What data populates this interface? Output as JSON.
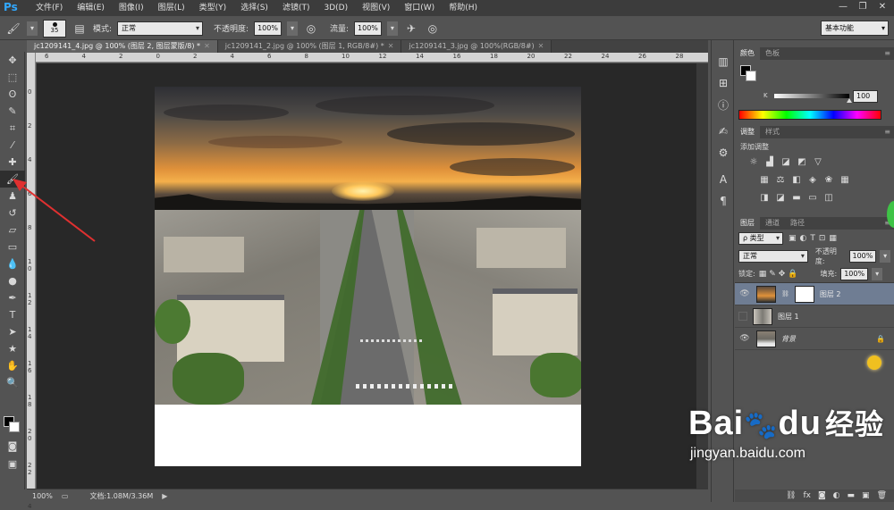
{
  "app": {
    "logo": "Ps"
  },
  "menu": [
    "文件(F)",
    "编辑(E)",
    "图像(I)",
    "图层(L)",
    "类型(Y)",
    "选择(S)",
    "滤镜(T)",
    "3D(D)",
    "视图(V)",
    "窗口(W)",
    "帮助(H)"
  ],
  "window_controls": [
    "—",
    "❐",
    "✕"
  ],
  "options": {
    "brush_size": "35",
    "mode_label": "模式:",
    "mode_value": "正常",
    "opacity_label": "不透明度:",
    "opacity_value": "100%",
    "flow_label": "流量:",
    "flow_value": "100%",
    "workspace": "基本功能"
  },
  "tabs": [
    {
      "label": "jc1209141_4.jpg @ 100% (图层 2, 图层蒙版/8) *",
      "active": true
    },
    {
      "label": "jc1209141_2.jpg @ 100% (图层 1, RGB/8#) *",
      "active": false
    },
    {
      "label": "jc1209141_3.jpg @ 100%(RGB/8#)",
      "active": false
    }
  ],
  "ruler_top": [
    "6",
    "4",
    "2",
    "0",
    "2",
    "4",
    "6",
    "8",
    "10",
    "12",
    "14",
    "16",
    "18",
    "20",
    "22",
    "24",
    "26",
    "28"
  ],
  "ruler_left": [
    "0",
    "2",
    "4",
    "6",
    "8",
    "1 0",
    "1 2",
    "1 4",
    "1 6",
    "1 8",
    "2 0",
    "2 2",
    "2 4"
  ],
  "status": {
    "zoom": "100%",
    "doc_info": "文档:1.08M/3.36M"
  },
  "color_panel": {
    "tabs": [
      "颜色",
      "色板"
    ],
    "channel_label": "K",
    "channel_value": "100",
    "channel_level": 1.0
  },
  "adjust_panel": {
    "tabs": [
      "调整",
      "样式"
    ],
    "title": "添加调整"
  },
  "layers_panel": {
    "tabs": [
      "图层",
      "通道",
      "路径"
    ],
    "filter_label": "ρ 类型",
    "blend_mode": "正常",
    "opacity_label": "不透明度:",
    "opacity_value": "100%",
    "lock_label": "锁定:",
    "fill_label": "填充:",
    "fill_value": "100%",
    "layers": [
      {
        "name": "图层 2",
        "selected": true,
        "visible": true
      },
      {
        "name": "图层 1",
        "selected": false,
        "visible": false
      },
      {
        "name": "背景",
        "selected": false,
        "visible": true
      }
    ]
  },
  "colors": {
    "selected_layer": "#6f7d93",
    "canvas_bg": "#282828",
    "ui_bg": "#535353",
    "annotation_arrow": "#e03030",
    "watermark": "#ffffff"
  },
  "watermark": {
    "brand": "Bai",
    "brand2": "du",
    "cn": "经验",
    "url": "jingyan.baidu.com"
  }
}
